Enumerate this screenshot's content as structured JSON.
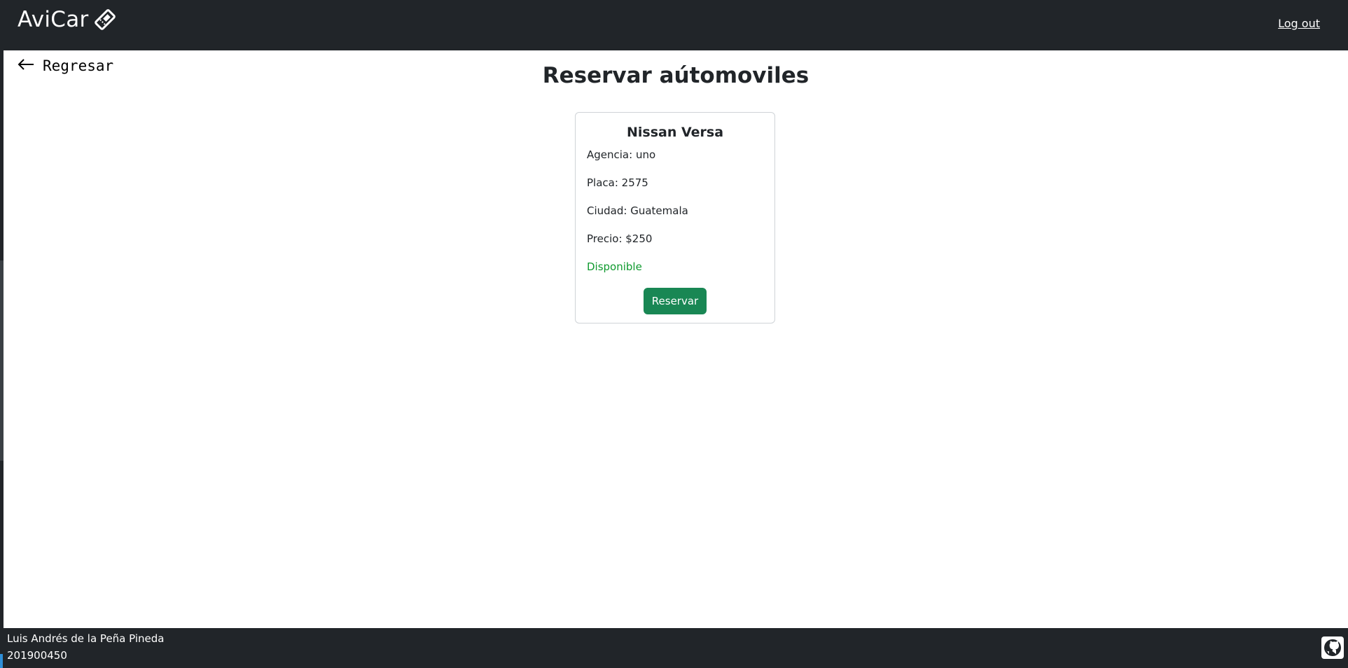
{
  "navbar": {
    "brand": "AviCar",
    "brand_icon": "ticket-icon",
    "logout_label": "Log out"
  },
  "back": {
    "label": "Regresar",
    "icon": "arrow-left-icon"
  },
  "page": {
    "title": "Reservar aútomoviles"
  },
  "card": {
    "title": "Nissan Versa",
    "agency": "Agencia: uno",
    "plate": "Placa: 2575",
    "city": "Ciudad: Guatemala",
    "price": "Precio: $250",
    "status": "Disponible",
    "status_color": "#0f9a2e",
    "button_label": "Reservar",
    "button_color": "#198754"
  },
  "footer": {
    "name": "Luis Andrés de la Peña Pineda",
    "id": "201900450",
    "icon": "github-icon"
  },
  "colors": {
    "navbar_bg": "#212529",
    "page_bg": "#ffffff"
  }
}
